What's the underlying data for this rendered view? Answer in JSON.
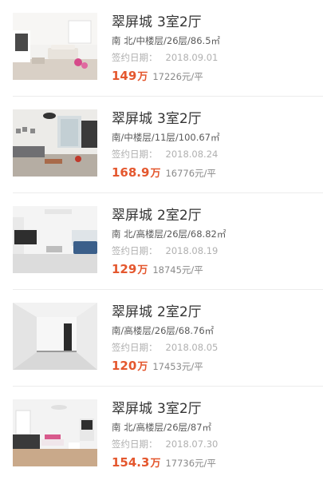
{
  "listings": [
    {
      "community": "翠屏城",
      "rooms": "3室2厅",
      "details": "南 北/中楼层/26层/86.5㎡",
      "date_label": "签约日期：",
      "date": "2018.09.01",
      "price": "149",
      "price_unit": "万",
      "unit_price": "17226元/平",
      "thumbnail": "living-room-photo"
    },
    {
      "community": "翠屏城",
      "rooms": "3室2厅",
      "details": "南/中楼层/11层/100.67㎡",
      "date_label": "签约日期：",
      "date": "2018.08.24",
      "price": "168.9",
      "price_unit": "万",
      "unit_price": "16776元/平",
      "thumbnail": "living-room-photo"
    },
    {
      "community": "翠屏城",
      "rooms": "2室2厅",
      "details": "南 北/高楼层/26层/68.82㎡",
      "date_label": "签约日期：",
      "date": "2018.08.19",
      "price": "129",
      "price_unit": "万",
      "unit_price": "18745元/平",
      "thumbnail": "living-room-photo"
    },
    {
      "community": "翠屏城",
      "rooms": "2室2厅",
      "details": "南/高楼层/26层/68.76㎡",
      "date_label": "签约日期：",
      "date": "2018.08.05",
      "price": "120",
      "price_unit": "万",
      "unit_price": "17453元/平",
      "thumbnail": "empty-room-photo"
    },
    {
      "community": "翠屏城",
      "rooms": "3室2厅",
      "details": "南 北/高楼层/26层/87㎡",
      "date_label": "签约日期：",
      "date": "2018.07.30",
      "price": "154.3",
      "price_unit": "万",
      "unit_price": "17736元/平",
      "thumbnail": "living-room-photo"
    }
  ],
  "colors": {
    "price": "#e4572e",
    "title": "#333333",
    "meta": "#5a5a5a",
    "muted": "#b0b0b0"
  }
}
